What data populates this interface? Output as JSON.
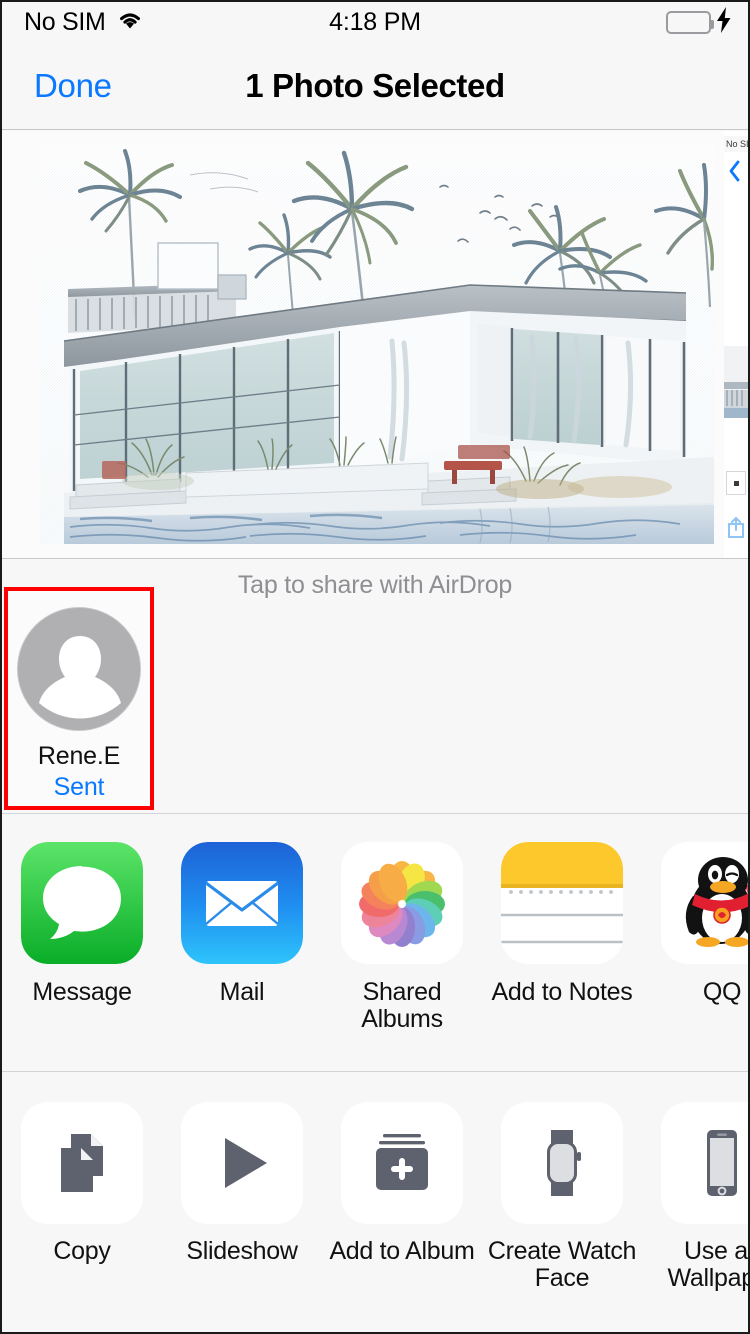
{
  "status_bar": {
    "carrier": "No SIM",
    "wifi_icon": "wifi-icon",
    "time": "4:18 PM",
    "battery_icon": "battery-full-icon",
    "charging_icon": "lightning-bolt-icon",
    "battery_color": "#4cd964"
  },
  "nav_bar": {
    "done_label": "Done",
    "title": "1 Photo Selected",
    "accent_color": "#0a79ff"
  },
  "photo_strip": {
    "selected_badge_icon": "checkmark-circle-icon",
    "badge_color": "#1a7cf0",
    "photo_description": "sketch-rendering-modern-house-palm-trees-pool",
    "background_peek": {
      "carrier_fragment": "No SIM",
      "back_icon": "chevron-left-icon",
      "share_icon": "share-up-arrow-icon"
    }
  },
  "airdrop": {
    "hint": "Tap to share with AirDrop",
    "hint_color": "#8e8e93",
    "contacts": [
      {
        "avatar_icon": "person-placeholder-icon",
        "name": "Rene.E",
        "status": "Sent",
        "status_color": "#0a79ff",
        "highlighted": true,
        "highlight_color": "#ff0000"
      }
    ]
  },
  "app_row": [
    {
      "icon": "messages-app-icon",
      "label": "Message"
    },
    {
      "icon": "mail-app-icon",
      "label": "Mail"
    },
    {
      "icon": "photos-shared-albums-icon",
      "label": "Shared Albums"
    },
    {
      "icon": "notes-app-icon",
      "label": "Add to Notes"
    },
    {
      "icon": "qq-app-icon",
      "label": "QQ"
    }
  ],
  "action_row": [
    {
      "icon": "copy-documents-icon",
      "label": "Copy"
    },
    {
      "icon": "play-triangle-icon",
      "label": "Slideshow"
    },
    {
      "icon": "add-to-album-icon",
      "label": "Add to Album"
    },
    {
      "icon": "apple-watch-icon",
      "label": "Create Watch Face"
    },
    {
      "icon": "iphone-icon",
      "label": "Use as Wallpaper"
    }
  ]
}
